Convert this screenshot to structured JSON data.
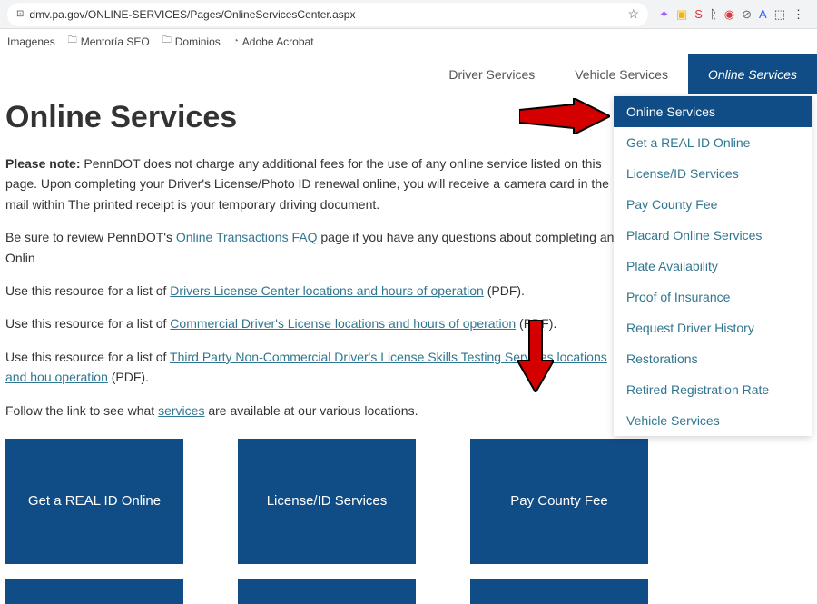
{
  "browser": {
    "url": "dmv.pa.gov/ONLINE-SERVICES/Pages/OnlineServicesCenter.aspx"
  },
  "bookmarks": {
    "b0": "Imagenes",
    "b1": "Mentoría SEO",
    "b2": "Dominios",
    "b3": "Adobe Acrobat"
  },
  "nav": {
    "t0": "Driver Services",
    "t1": "Vehicle Services",
    "t2": "Online Services"
  },
  "page": {
    "title": "Online Services",
    "note_label": "Please note:",
    "note_text": " PennDOT does not charge any additional fees for the use of any online service listed on this page. Upon completing your Driver's License/Photo ID renewal online, you will receive a camera card in the mail within The printed receipt is your temporary driving document.",
    "faq_pre": "Be sure to review PennDOT's ",
    "faq_link": "Online Transactions FAQ",
    "faq_post": " page if you have any questions about completing an Onlin",
    "res1_pre": "Use this resource for a list of ",
    "res1_link": "Drivers License Center locations and hours of operation",
    "res1_post": " (PDF).",
    "res2_pre": "Use this resource for a list of ",
    "res2_link": "Commercial Driver's License locations and hours of operation",
    "res2_post": " (PDF).",
    "res3_pre": "Use this resource for a list of ",
    "res3_link": "Third Party Non-Commercial Driver's License Skills Testing Services locations and hou operation",
    "res3_post": " (PDF).",
    "follow_pre": "Follow the link to see what ",
    "follow_link": "services",
    "follow_post": " are available at our various locations."
  },
  "tiles": {
    "t0": "Get a REAL ID Online",
    "t1": "License/ID Services",
    "t2": "Pay County Fee"
  },
  "dropdown": {
    "d0": "Online Services",
    "d1": "Get a REAL ID Online",
    "d2": "License/ID Services",
    "d3": "Pay County Fee",
    "d4": "Placard Online Services",
    "d5": "Plate Availability",
    "d6": "Proof of Insurance",
    "d7": "Request Driver History",
    "d8": "Restorations",
    "d9": "Retired Registration Rate",
    "d10": "Vehicle Services"
  }
}
